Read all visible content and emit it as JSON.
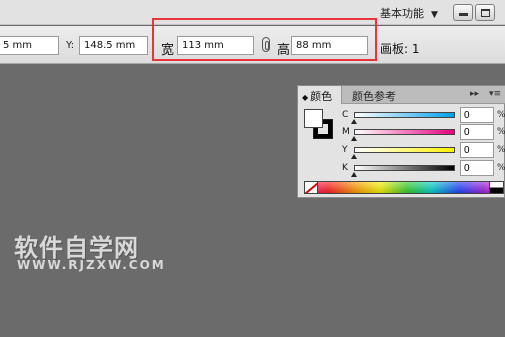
{
  "titlebar": {
    "workspace_label": "基本功能",
    "workspace_arrow": "▼"
  },
  "control_bar": {
    "x_value": "5 mm",
    "y_label": "Y:",
    "y_value": "148.5 mm",
    "width_label": "宽",
    "width_value": "113 mm",
    "height_label": "高",
    "height_value": "88 mm",
    "artboard_label": "画板: 1"
  },
  "color_panel": {
    "tabs": [
      {
        "label": "颜色",
        "active": true,
        "glyph": "◆"
      },
      {
        "label": "颜色参考",
        "active": false
      }
    ],
    "menu_glyphs": {
      "expand": "▸▸",
      "menu": "▾≡"
    },
    "channels": [
      {
        "label": "C",
        "value": "0",
        "unit": "%",
        "gradient_from": "#ffffff",
        "gradient_to": "#00a0e9"
      },
      {
        "label": "M",
        "value": "0",
        "unit": "%",
        "gradient_from": "#ffffff",
        "gradient_to": "#e4007f"
      },
      {
        "label": "Y",
        "value": "0",
        "unit": "%",
        "gradient_from": "#ffffff",
        "gradient_to": "#fff100"
      },
      {
        "label": "K",
        "value": "0",
        "unit": "%",
        "gradient_from": "#ffffff",
        "gradient_to": "#000000"
      }
    ]
  },
  "watermark": {
    "title": "软件自学网",
    "url": "WWW.RJZXW.COM"
  },
  "colors": {
    "highlight_border": "#e8353a",
    "canvas_bg": "#6b6b6b",
    "panel_bg": "#e3e3e3"
  }
}
